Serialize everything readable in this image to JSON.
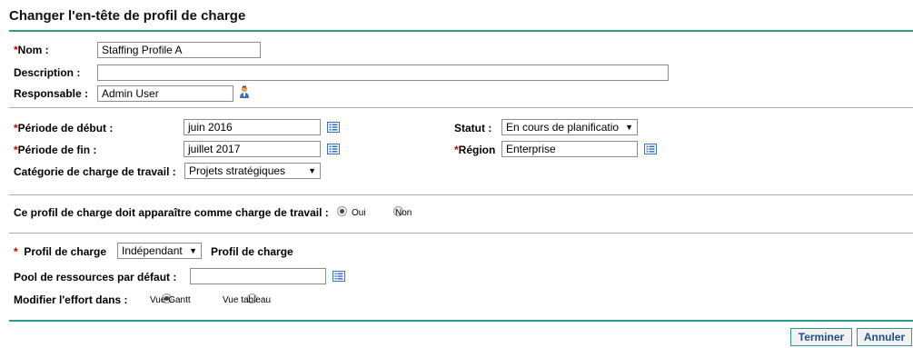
{
  "page": {
    "title": "Changer l'en-tête de profil de charge"
  },
  "header": {
    "name_label": "Nom :",
    "name_value": "Staffing Profile A",
    "description_label": "Description :",
    "description_value": "",
    "owner_label": "Responsable :",
    "owner_value": "Admin User"
  },
  "period": {
    "start_label": "Période de début :",
    "start_value": "juin 2016",
    "end_label": "Période de fin :",
    "end_value": "juillet 2017",
    "category_label": "Catégorie de charge de travail :",
    "category_value": "Projets stratégiques",
    "status_label": "Statut :",
    "status_value": "En cours de planificatio",
    "region_label": "Région",
    "region_value": "Enterprise"
  },
  "workload": {
    "question": "Ce profil de charge doit apparaître comme charge de travail :",
    "options": [
      "Oui",
      "Non"
    ],
    "selected": "Oui"
  },
  "profile": {
    "type_label": "Profil de charge",
    "type_value": "Indépendant",
    "type_suffix": "Profil de charge",
    "pool_label": "Pool de ressources par défaut :",
    "pool_value": "",
    "effort_label": "Modifier l'effort dans :",
    "effort_options": [
      "Vue Gantt",
      "Vue tableau"
    ],
    "effort_selected": "Vue Gantt"
  },
  "buttons": {
    "finish": "Terminer",
    "cancel": "Annuler"
  },
  "colors": {
    "accent": "#2b9b8a",
    "required": "#cc0000",
    "link_text": "#1d4f8a",
    "icon_blue": "#3a6fc4"
  },
  "icons": {
    "owner": "person-icon",
    "picker": "list-picker-icon"
  }
}
